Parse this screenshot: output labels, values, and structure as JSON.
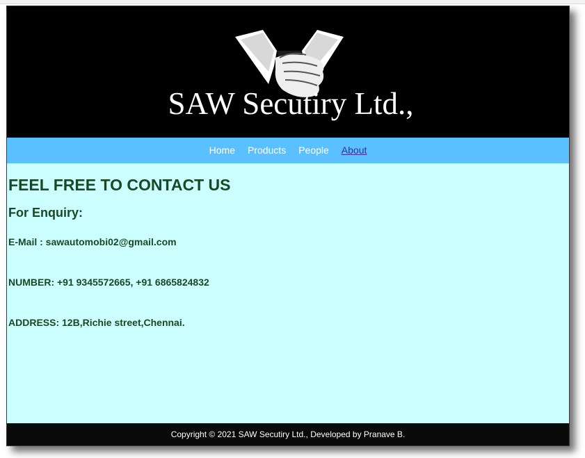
{
  "header": {
    "title": "SAW Secutiry Ltd.,",
    "logo_icon": "suit-collar-hand-logo-icon"
  },
  "nav": {
    "items": [
      {
        "label": "Home"
      },
      {
        "label": "Products"
      },
      {
        "label": "People"
      },
      {
        "label": "About"
      }
    ],
    "active": "About"
  },
  "main": {
    "heading": "FEEL FREE TO CONTACT US",
    "subheading": "For Enquiry:",
    "email": "E-Mail : sawautomobi02@gmail.com",
    "number": "NUMBER: +91 9345572665, +91 6865824832",
    "address": "ADDRESS: 12B,Richie street,Chennai."
  },
  "footer": {
    "text": "Copyright © 2021 SAW Secutiry Ltd., Developed by Pranave B."
  },
  "colors": {
    "header_bg": "#000000",
    "nav_bg": "#5bc0ff",
    "content_bg": "#ccffff",
    "text": "#1a4724",
    "footer_bg": "#0a0a0a",
    "active_link": "#3a2d94"
  }
}
